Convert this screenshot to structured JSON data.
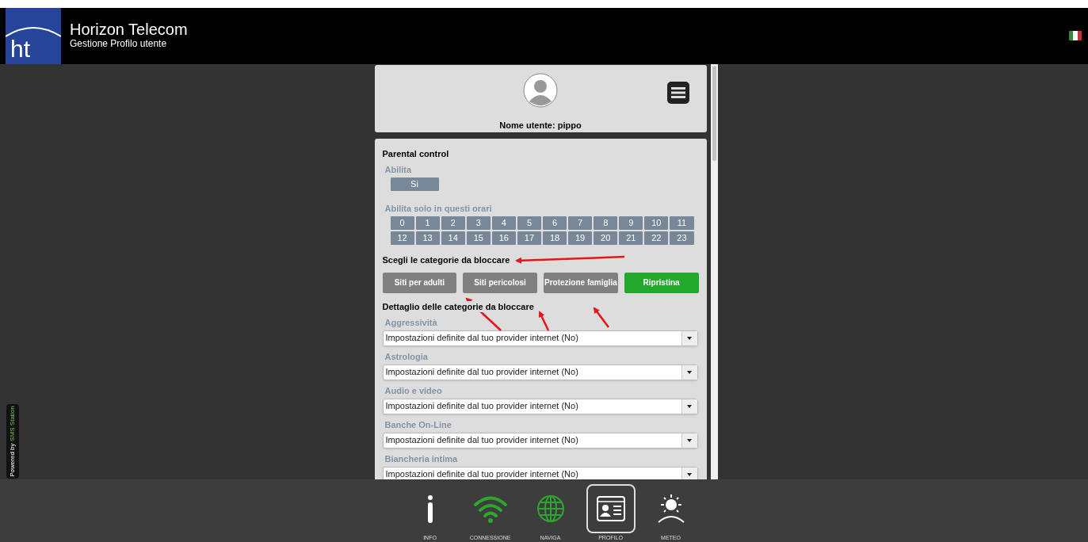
{
  "header": {
    "logo": "ht",
    "title": "Horizon Telecom",
    "subtitle": "Gestione Profilo utente"
  },
  "profile": {
    "username": "Nome utente: pippo"
  },
  "parental": {
    "title": "Parental control",
    "enable_label": "Abilita",
    "enable_value": "Si",
    "hours_label": "Abilita solo in questi orari",
    "hours": [
      "0",
      "1",
      "2",
      "3",
      "4",
      "5",
      "6",
      "7",
      "8",
      "9",
      "10",
      "11",
      "12",
      "13",
      "14",
      "15",
      "16",
      "17",
      "18",
      "19",
      "20",
      "21",
      "22",
      "23"
    ],
    "categories_title": "Scegli le categorie da bloccare",
    "buttons": [
      {
        "label": "Siti per adulti",
        "kind": "preset"
      },
      {
        "label": "Siti pericolosi",
        "kind": "preset"
      },
      {
        "label": "Protezione famiglia",
        "kind": "preset"
      },
      {
        "label": "Ripristina",
        "kind": "reset"
      }
    ],
    "detail_title": "Dettaglio delle categorie da bloccare",
    "categories": [
      {
        "label": "Aggressività",
        "value": "Impostazioni definite dal tuo provider internet (No)"
      },
      {
        "label": "Astrologia",
        "value": "Impostazioni definite dal tuo provider internet (No)"
      },
      {
        "label": "Audio e video",
        "value": "Impostazioni definite dal tuo provider internet (No)"
      },
      {
        "label": "Banche On-Line",
        "value": "Impostazioni definite dal tuo provider internet (No)"
      },
      {
        "label": "Biancheria intima",
        "value": "Impostazioni definite dal tuo provider internet (No)"
      }
    ]
  },
  "powered_by": {
    "prefix": "Powered by",
    "brand": "SMS Station"
  },
  "nav": [
    {
      "label": "INFO",
      "kind": "info",
      "color": "#ffffff",
      "selected": false
    },
    {
      "label": "CONNESSIONE",
      "kind": "wifi",
      "color": "#2ea52e",
      "selected": false
    },
    {
      "label": "NAVIGA",
      "kind": "globe",
      "color": "#2ea52e",
      "selected": false
    },
    {
      "label": "PROFILO",
      "kind": "profile",
      "color": "#ffffff",
      "selected": true
    },
    {
      "label": "METEO",
      "kind": "weather",
      "color": "#ffffff",
      "selected": false
    }
  ]
}
